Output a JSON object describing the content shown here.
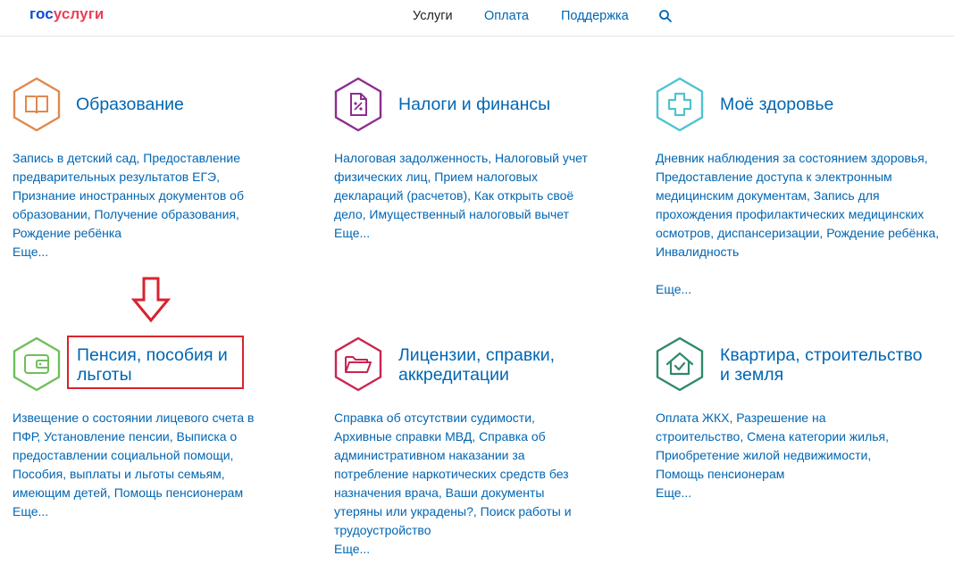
{
  "header": {
    "logo_part1": "гос",
    "logo_part2": "услуги",
    "nav": [
      "Услуги",
      "Оплата",
      "Поддержка"
    ],
    "search_icon": "search-icon"
  },
  "cards": [
    {
      "title": "Образование",
      "icon": "book-icon",
      "color": "#e0884c",
      "links": "Запись в детский сад, Предоставление предварительных результатов ЕГЭ, Признание иностранных документов об образовании, Получение образования, Рождение ребёнка",
      "more": "Еще..."
    },
    {
      "title": "Налоги и финансы",
      "icon": "tax-document-icon",
      "color": "#8e2d8e",
      "links": "Налоговая задолженность, Налоговый учет физических лиц, Прием налоговых деклараций (расчетов), Как открыть своё дело, Имущественный налоговый вычет",
      "more": "Еще..."
    },
    {
      "title": "Моё здоровье",
      "icon": "medical-cross-icon",
      "color": "#4fc3cf",
      "links": "Дневник наблюдения за состоянием здоровья, Предоставление доступа к электронным медицинским документам, Запись для прохождения профилактических медицинских осмотров, диспансеризации, Рождение ребёнка, Инвалидность",
      "more": "Еще..."
    },
    {
      "title": "Пенсия, пособия и льготы",
      "icon": "wallet-icon",
      "color": "#6fbf5b",
      "links": "Извещение о состоянии лицевого счета в ПФР, Установление пенсии, Выписка о предоставлении социальной помощи, Пособия, выплаты и льготы семьям, имеющим детей, Помощь пенсионерам",
      "more": "Еще..."
    },
    {
      "title": "Лицензии, справки, аккредитации",
      "icon": "folder-icon",
      "color": "#c9254f",
      "links": "Справка об отсутствии судимости, Архивные справки МВД, Справка об административном наказании за потребление наркотических средств без назначения врача, Ваши документы утеряны или украдены?, Поиск работы и трудоустройство",
      "more": "Еще..."
    },
    {
      "title": "Квартира, строительство и земля",
      "icon": "house-check-icon",
      "color": "#2f8a6a",
      "links": "Оплата ЖКХ, Разрешение на строительство, Смена категории жилья, Приобретение жилой недвижимости, Помощь пенсионерам",
      "more": "Еще..."
    }
  ]
}
